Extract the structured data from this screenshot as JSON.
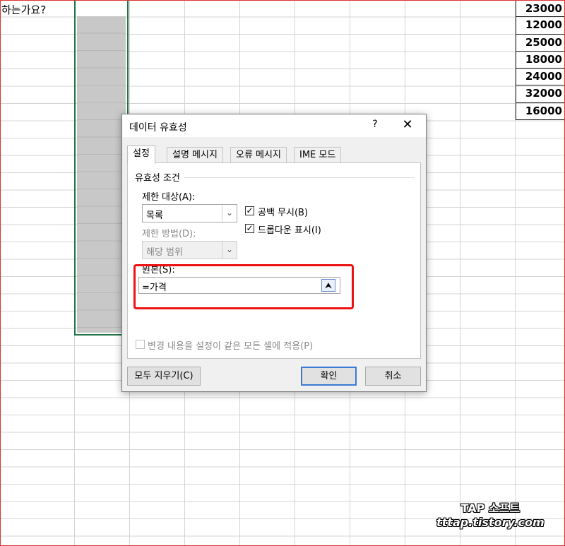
{
  "sheet": {
    "question_text": "하는가요?",
    "prices": [
      "23000",
      "12000",
      "25000",
      "18000",
      "24000",
      "32000",
      "16000"
    ],
    "selection_color": "#217346"
  },
  "dialog": {
    "title": "데이터 유효성",
    "help_glyph": "?",
    "close_glyph": "✕",
    "tabs": [
      "설정",
      "설명 메시지",
      "오류 메시지",
      "IME 모드"
    ],
    "active_tab": "설정",
    "group_label": "유효성 조건",
    "allow_label": "제한 대상(A):",
    "allow_value": "목록",
    "data_label": "제한 방법(D):",
    "data_value": "해당 범위",
    "ignore_blank_label": "공백 무시(B)",
    "ignore_blank_checked": true,
    "dropdown_label": "드롭다운 표시(I)",
    "dropdown_checked": true,
    "source_label": "원본(S):",
    "source_value": "=가격",
    "apply_all_label": "변경 내용을 설정이 같은 모든 셀에 적용(P)",
    "clear_all_label": "모두 지우기(C)",
    "ok_label": "확인",
    "cancel_label": "취소",
    "accent_color": "#3b7bd6",
    "highlight_color": "#e11111"
  },
  "watermark": {
    "line1": "TAP 소프트",
    "line2": "tttap.tistory.com"
  }
}
